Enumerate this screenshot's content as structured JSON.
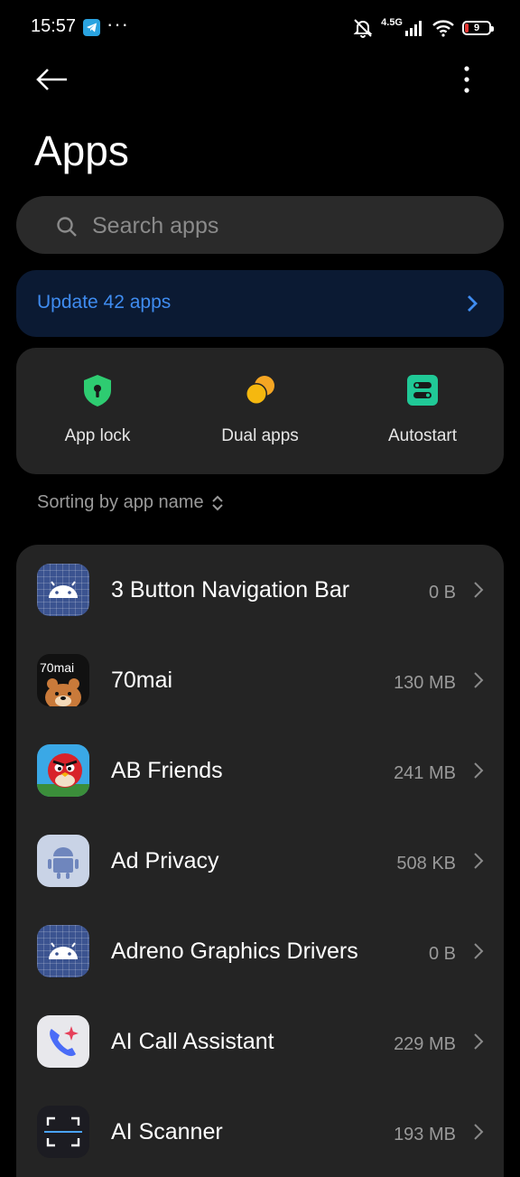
{
  "status_bar": {
    "time": "15:57",
    "network": "4.5G",
    "battery": "9",
    "icons": [
      "telegram-icon",
      "more-dots-icon",
      "muted-bell-icon",
      "signal-icon",
      "wifi-icon",
      "battery-icon"
    ]
  },
  "header": {
    "title": "Apps",
    "back_icon": "arrow-left-icon",
    "menu_icon": "more-vertical-icon"
  },
  "search": {
    "placeholder": "Search apps",
    "icon": "search-icon"
  },
  "update_banner": {
    "label": "Update 42 apps",
    "color": "#3f8cf0"
  },
  "quick_actions": [
    {
      "label": "App lock",
      "icon": "shield-lock-icon",
      "color": "#2ecc71"
    },
    {
      "label": "Dual apps",
      "icon": "dual-circles-icon",
      "color": "#f5a623"
    },
    {
      "label": "Autostart",
      "icon": "autostart-icon",
      "color": "#20c997"
    }
  ],
  "sorting": {
    "label": "Sorting by app name"
  },
  "apps": [
    {
      "name": "3 Button Navigation Bar",
      "size": "0 B"
    },
    {
      "name": "70mai",
      "size": "130 MB",
      "icon_text": "70mai"
    },
    {
      "name": "AB Friends",
      "size": "241 MB"
    },
    {
      "name": "Ad Privacy",
      "size": "508 KB"
    },
    {
      "name": "Adreno Graphics Drivers",
      "size": "0 B"
    },
    {
      "name": "AI Call Assistant",
      "size": "229 MB"
    },
    {
      "name": "AI Scanner",
      "size": "193 MB"
    }
  ]
}
